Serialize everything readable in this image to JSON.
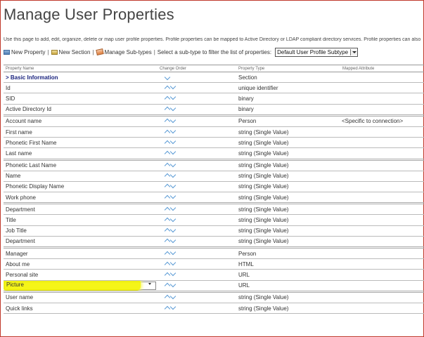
{
  "page": {
    "title": "Manage User Properties",
    "description": "Use this page to add, edit, organize, delete or map user profile properties. Profile properties can be mapped to Active Directory or LDAP compliant directory services. Profile properties can also"
  },
  "toolbar": {
    "new_property": "New Property",
    "new_section": "New Section",
    "manage_subtypes": "Manage Sub-types",
    "separator": "|",
    "filter_label": "Select a sub-type to filter the list of properties:",
    "subtype_value": "Default User Profile Subtype"
  },
  "columns": {
    "name": "Property Name",
    "order": "Change Order",
    "type": "Property Type",
    "mapped": "Mapped Attribute"
  },
  "rows": [
    {
      "name": "> Basic Information",
      "type": "Section",
      "mapped": ""
    },
    {
      "name": "Id",
      "type": "unique identifier",
      "mapped": ""
    },
    {
      "name": "SID",
      "type": "binary",
      "mapped": ""
    },
    {
      "name": "Active Directory Id",
      "type": "binary",
      "mapped": ""
    },
    {
      "name": "Account name",
      "type": "Person",
      "mapped": "<Specific to connection>"
    },
    {
      "name": "First name",
      "type": "string (Single Value)",
      "mapped": ""
    },
    {
      "name": "Phonetic First Name",
      "type": "string (Single Value)",
      "mapped": ""
    },
    {
      "name": "Last name",
      "type": "string (Single Value)",
      "mapped": ""
    },
    {
      "name": "Phonetic Last Name",
      "type": "string (Single Value)",
      "mapped": ""
    },
    {
      "name": "Name",
      "type": "string (Single Value)",
      "mapped": ""
    },
    {
      "name": "Phonetic Display Name",
      "type": "string (Single Value)",
      "mapped": ""
    },
    {
      "name": "Work phone",
      "type": "string (Single Value)",
      "mapped": ""
    },
    {
      "name": "Department",
      "type": "string (Single Value)",
      "mapped": ""
    },
    {
      "name": "Title",
      "type": "string (Single Value)",
      "mapped": ""
    },
    {
      "name": "Job Title",
      "type": "string (Single Value)",
      "mapped": ""
    },
    {
      "name": "Department",
      "type": "string (Single Value)",
      "mapped": ""
    },
    {
      "name": "Manager",
      "type": "Person",
      "mapped": ""
    },
    {
      "name": "About me",
      "type": "HTML",
      "mapped": ""
    },
    {
      "name": "Personal site",
      "type": "URL",
      "mapped": ""
    },
    {
      "name": "Picture",
      "type": "URL",
      "mapped": ""
    },
    {
      "name": "User name",
      "type": "string (Single Value)",
      "mapped": ""
    },
    {
      "name": "Quick links",
      "type": "string (Single Value)",
      "mapped": ""
    }
  ],
  "colors": {
    "highlight": "#f4f400",
    "section_text": "#1a237e",
    "arrow": "#5b9bd5",
    "frame_border": "#c0392b"
  },
  "icons": {
    "new_property": "new-property-icon",
    "new_section": "new-section-icon",
    "manage_subtypes": "manage-subtypes-icon",
    "order_up": "arrow-up-icon",
    "order_down": "arrow-down-icon"
  }
}
